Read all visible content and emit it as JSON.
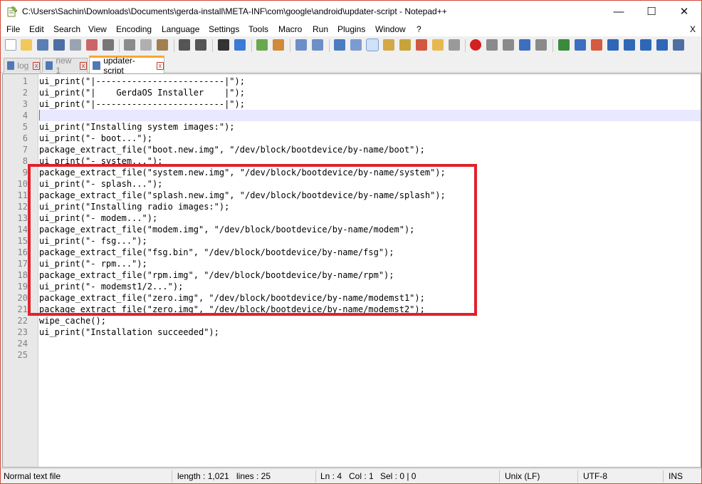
{
  "window": {
    "title": "C:\\Users\\Sachin\\Downloads\\Documents\\gerda-install\\META-INF\\com\\google\\android\\updater-script - Notepad++",
    "minimize_glyph": "—",
    "maximize_glyph": "☐",
    "close_glyph": "✕"
  },
  "menu": {
    "items": [
      "File",
      "Edit",
      "Search",
      "View",
      "Encoding",
      "Language",
      "Settings",
      "Tools",
      "Macro",
      "Run",
      "Plugins",
      "Window",
      "?"
    ],
    "close_label": "X"
  },
  "tabs": [
    {
      "label": "log",
      "active": false
    },
    {
      "label": "new 1",
      "active": false
    },
    {
      "label": "updater-script",
      "active": true
    }
  ],
  "tab_close_glyph": "x",
  "editor": {
    "current_line": 4,
    "lines": [
      "ui_print(\"|-------------------------|\");",
      "ui_print(\"|    GerdaOS Installer    |\");",
      "ui_print(\"|-------------------------|\");",
      "",
      "ui_print(\"Installing system images:\");",
      "ui_print(\"- boot...\");",
      "package_extract_file(\"boot.new.img\", \"/dev/block/bootdevice/by-name/boot\");",
      "ui_print(\"- system...\");",
      "package_extract_file(\"system.new.img\", \"/dev/block/bootdevice/by-name/system\");",
      "ui_print(\"- splash...\");",
      "package_extract_file(\"splash.new.img\", \"/dev/block/bootdevice/by-name/splash\");",
      "ui_print(\"Installing radio images:\");",
      "ui_print(\"- modem...\");",
      "package_extract_file(\"modem.img\", \"/dev/block/bootdevice/by-name/modem\");",
      "ui_print(\"- fsg...\");",
      "package_extract_file(\"fsg.bin\", \"/dev/block/bootdevice/by-name/fsg\");",
      "ui_print(\"- rpm...\");",
      "package_extract_file(\"rpm.img\", \"/dev/block/bootdevice/by-name/rpm\");",
      "ui_print(\"- modemst1/2...\");",
      "package_extract_file(\"zero.img\", \"/dev/block/bootdevice/by-name/modemst1\");",
      "package_extract_file(\"zero.img\", \"/dev/block/bootdevice/by-name/modemst2\");",
      "wipe_cache();",
      "ui_print(\"Installation succeeded\");",
      "",
      ""
    ],
    "line_numbers": [
      "1",
      "2",
      "3",
      "4",
      "5",
      "6",
      "7",
      "8",
      "9",
      "10",
      "11",
      "12",
      "13",
      "14",
      "15",
      "16",
      "17",
      "18",
      "19",
      "20",
      "21",
      "22",
      "23",
      "24",
      "25"
    ]
  },
  "status": {
    "file_type": "Normal text file",
    "length": "length : 1,021",
    "lines": "lines : 25",
    "ln": "Ln : 4",
    "col": "Col : 1",
    "sel": "Sel : 0 | 0",
    "eol": "Unix (LF)",
    "encoding": "UTF-8",
    "mode": "INS"
  },
  "colors": {
    "highlight_box": "#e0212a",
    "active_tab_accent": "#f7a733",
    "current_line_bg": "#e8e8ff"
  }
}
